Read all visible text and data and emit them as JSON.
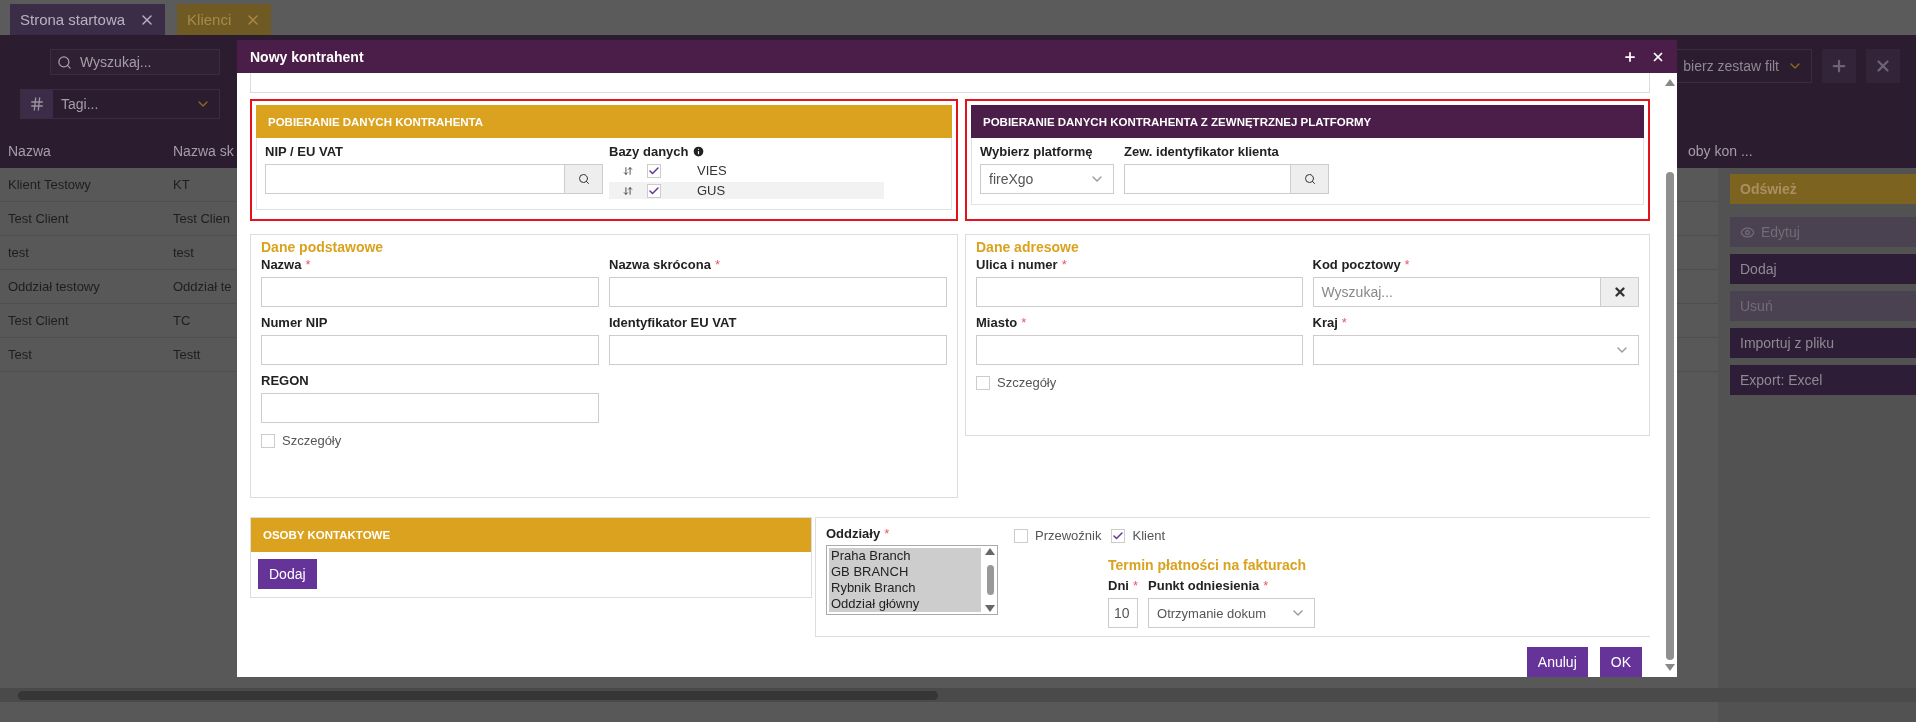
{
  "tabs": [
    {
      "label": "Strona startowa",
      "selected": false
    },
    {
      "label": "Klienci",
      "selected": true
    }
  ],
  "toolbar": {
    "search": {
      "placeholder": "Wyszukaj..."
    },
    "tags": {
      "placeholder": "Tagi..."
    },
    "filter_set": {
      "value": "bierz zestaw filt"
    }
  },
  "table": {
    "columns": [
      "Nazwa",
      "Nazwa sk",
      "oby kon ..."
    ],
    "rows": [
      [
        "Klient Testowy",
        "KT"
      ],
      [
        "Test Client",
        "Test Clien"
      ],
      [
        "test",
        "test"
      ],
      [
        "Oddział testowy",
        "Oddział te"
      ],
      [
        "Test Client",
        "TC"
      ],
      [
        "Test",
        "Testt"
      ]
    ]
  },
  "sidebar": [
    {
      "label": "Odśwież",
      "kind": "primary",
      "disabled": false
    },
    {
      "label": "Edytuj",
      "kind": "view",
      "disabled": true
    },
    {
      "label": "Dodaj",
      "kind": "plain",
      "disabled": false
    },
    {
      "label": "Usuń",
      "kind": "plain",
      "disabled": true
    },
    {
      "label": "Importuj z pliku",
      "kind": "plain",
      "disabled": false
    },
    {
      "label": "Export: Excel",
      "kind": "plain",
      "disabled": false
    }
  ],
  "dialog": {
    "title": "Nowy kontrahent",
    "fetch_panel": {
      "title": "POBIERANIE DANYCH KONTRAHENTA",
      "nip_label": "NIP / EU VAT",
      "databases_label": "Bazy danych",
      "databases": [
        {
          "name": "VIES",
          "checked": true
        },
        {
          "name": "GUS",
          "checked": true
        }
      ]
    },
    "external_panel": {
      "title": "POBIERANIE DANYCH KONTRAHENTA Z ZEWNĘTRZNEJ PLATFORMY",
      "platform_label": "Wybierz platformę",
      "platform_value": "fireXgo",
      "client_id_label": "Zew. identyfikator klienta"
    },
    "basic": {
      "title": "Dane podstawowe",
      "fields": [
        {
          "label": "Nazwa",
          "required_mark": "*"
        },
        {
          "label": "Nazwa skrócona",
          "required_mark": "*"
        },
        {
          "label": "Numer NIP"
        },
        {
          "label": "Identyfikator EU VAT"
        },
        {
          "label": "REGON"
        }
      ],
      "details": {
        "label": "Szczegóły",
        "checked": false
      }
    },
    "address": {
      "title": "Dane adresowe",
      "fields": [
        {
          "label": "Ulica i numer",
          "required_mark": "*",
          "kind": "text"
        },
        {
          "label": "Kod pocztowy",
          "required_mark": "*",
          "kind": "search",
          "placeholder": "Wyszukaj..."
        },
        {
          "label": "Miasto",
          "required_mark": "*",
          "kind": "text"
        },
        {
          "label": "Kraj",
          "required_mark": "*",
          "kind": "select"
        }
      ],
      "details": {
        "label": "Szczegóły",
        "checked": false
      }
    },
    "contacts": {
      "title": "OSOBY KONTAKTOWE",
      "add_button": "Dodaj"
    },
    "branches": {
      "label": "Oddziały",
      "required_mark": "*",
      "options": [
        {
          "label": "Praha Branch",
          "selected": true
        },
        {
          "label": "GB BRANCH",
          "selected": true
        },
        {
          "label": "Rybnik Branch",
          "selected": true
        },
        {
          "label": "Oddział główny",
          "selected": true
        }
      ]
    },
    "roles": [
      {
        "label": "Przewoźnik",
        "checked": false
      },
      {
        "label": "Klient",
        "checked": true
      }
    ],
    "payment": {
      "title": "Termin płatności na fakturach",
      "days_label": "Dni",
      "days_mark": "*",
      "days_value": "10",
      "reference_label": "Punkt odniesienia",
      "reference_mark": "*",
      "reference_value": "Otrzymanie dokum"
    },
    "buttons": [
      {
        "label": "Anuluj"
      },
      {
        "label": "OK"
      }
    ]
  }
}
